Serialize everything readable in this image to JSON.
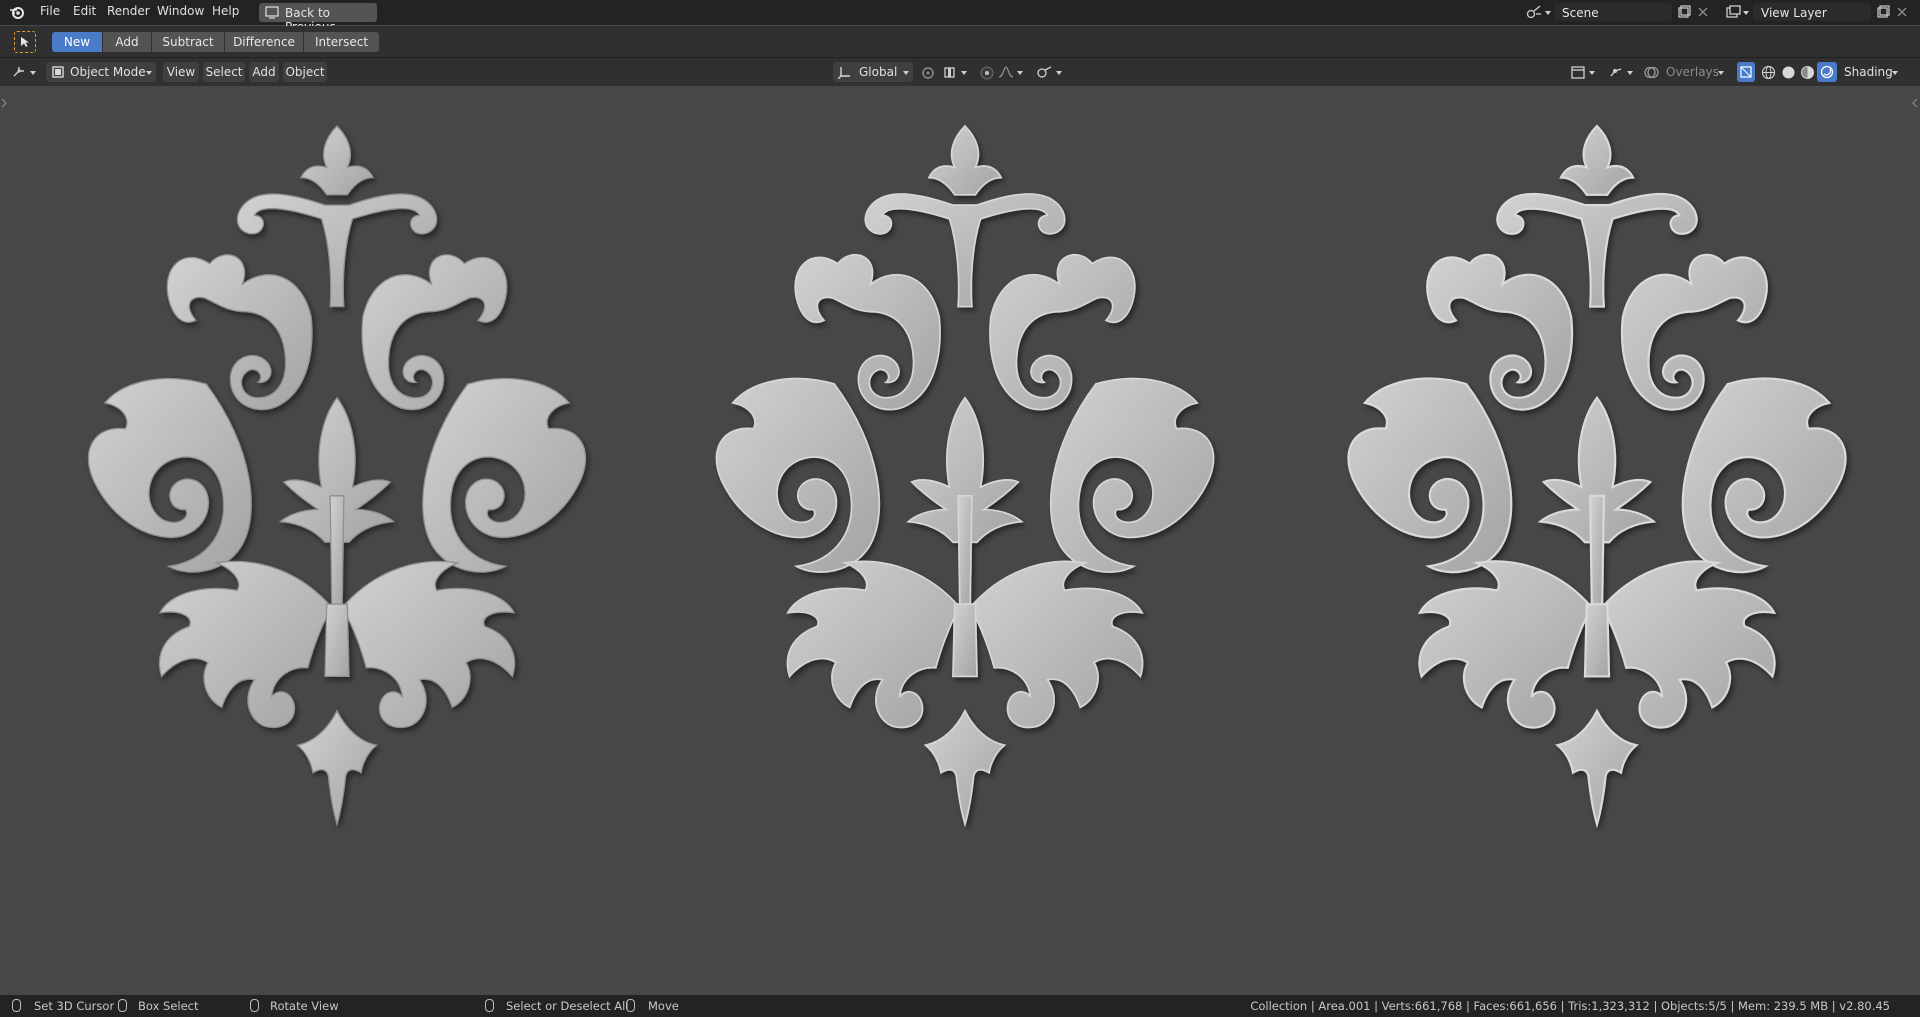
{
  "topbar": {
    "menus": [
      "File",
      "Edit",
      "Render",
      "Window",
      "Help"
    ],
    "back_label": "Back to Previous",
    "scene_label": "Scene",
    "view_layer_label": "View Layer"
  },
  "toolbar": {
    "ops": [
      "New",
      "Add",
      "Subtract",
      "Difference",
      "Intersect"
    ],
    "active_op": "New"
  },
  "header": {
    "mode": "Object Mode",
    "menus": [
      "View",
      "Select",
      "Add",
      "Object"
    ],
    "orientation": "Global",
    "overlays": "Overlays",
    "shading": "Shading"
  },
  "status": {
    "hints": [
      "Set 3D Cursor",
      "Box Select",
      "Rotate View",
      "Select or Deselect All",
      "Move"
    ],
    "stats": "Collection | Area.001 | Verts:661,768 | Faces:661,656 | Tris:1,323,312 | Objects:5/5 | Mem: 239.5 MB | v2.80.45"
  },
  "colors": {
    "accent": "#4a7bc8",
    "ornament": "#b9b9b9",
    "viewport_bg": "#474747"
  }
}
